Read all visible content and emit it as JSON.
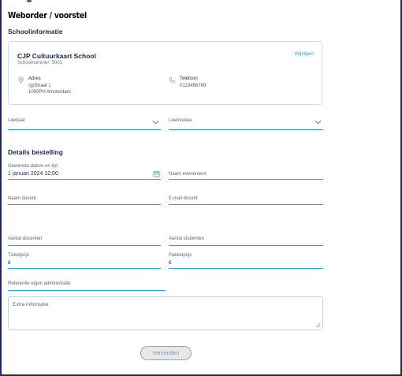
{
  "header": {
    "title": "Weborder / voorstel"
  },
  "school_section": {
    "title": "Schoolinformatie"
  },
  "school": {
    "name": "CJP Cultuurkaart School",
    "number": "Schoolnummer: 5001",
    "edit_label": "Wijzigen",
    "address_label": "Adres",
    "address_line1": "cjpStraat 1",
    "address_line2": "1000PH Amsterdam",
    "phone_label": "Telefoon",
    "phone_value": "0123456789"
  },
  "selects": {
    "leerjaar": "Leerjaar",
    "leerniveau": "Leerniveau"
  },
  "order_section": {
    "title": "Details bestelling"
  },
  "fields": {
    "datetime_label": "Gewenste datum en tijd",
    "datetime_value": "1 januari 2024 12:00",
    "event_label": "Naam evenement",
    "teacher_label": "Naam docent",
    "email_label": "E-mail docent",
    "num_teachers_label": "Aantal docenten",
    "num_students_label": "Aantal studenten",
    "ticket_price_label": "Ticketprijs",
    "ticket_price_currency": "€",
    "package_price_label": "Pakketprijs",
    "package_price_currency": "€",
    "reference_label": "Referentie eigen administratie",
    "extra_info_placeholder": "Extra informatie"
  },
  "actions": {
    "submit_label": "Verzenden"
  },
  "colors": {
    "accent": "#22a7d6",
    "link": "#2a9fd6",
    "frame": "#1f2b5c"
  }
}
